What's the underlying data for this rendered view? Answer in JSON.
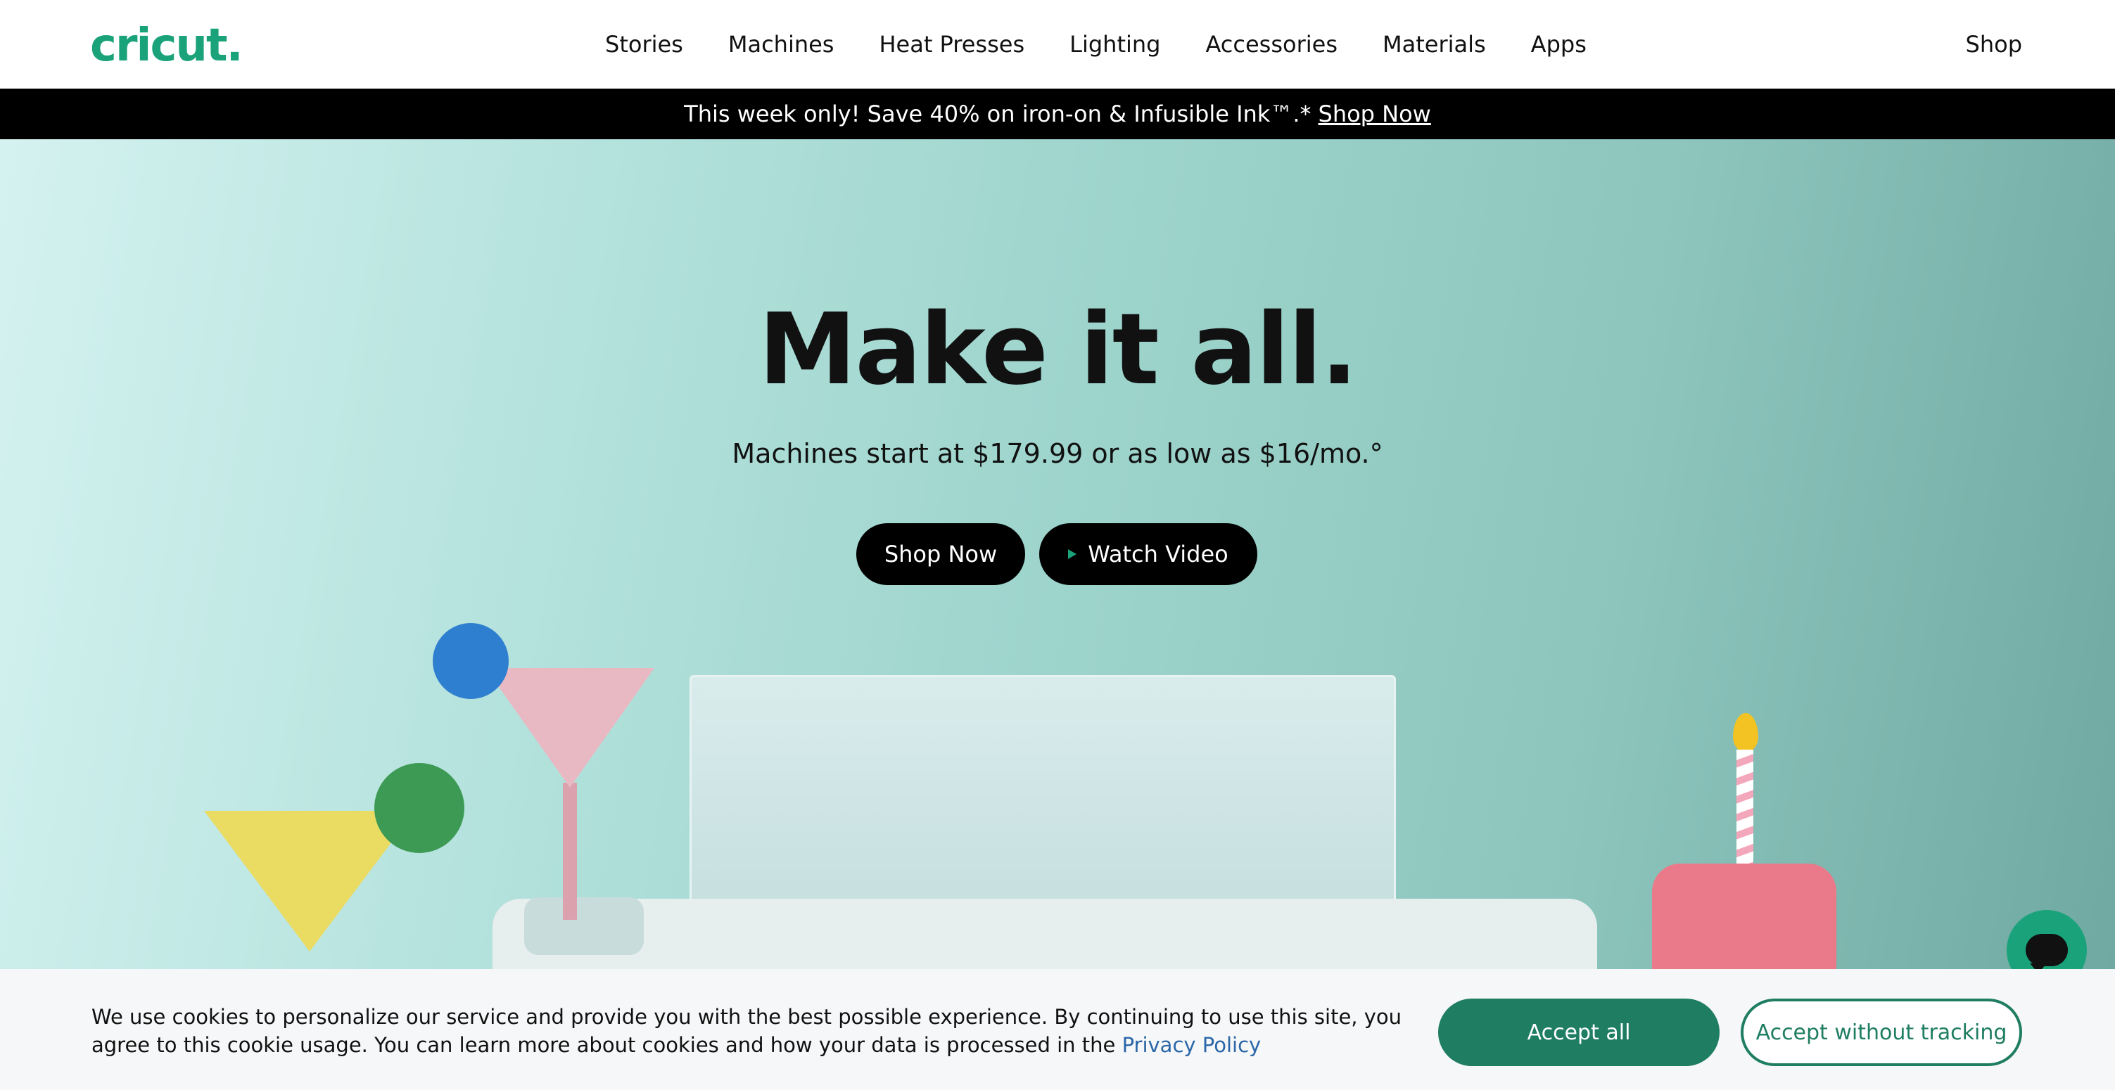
{
  "header": {
    "logo": "cricut.",
    "nav": [
      "Stories",
      "Machines",
      "Heat Presses",
      "Lighting",
      "Accessories",
      "Materials",
      "Apps"
    ],
    "shop": "Shop"
  },
  "promo": {
    "text": "This week only! Save 40% on iron-on & Infusible Ink™.*",
    "link": "Shop Now"
  },
  "hero": {
    "title": "Make it all.",
    "subtitle": "Machines start at $179.99 or as low as $16/mo.°",
    "shop_button": "Shop Now",
    "watch_button": "Watch Video"
  },
  "cookie": {
    "text": "We use cookies to personalize our service and provide you with the best possible experience. By continuing to use this site, you agree to this cookie usage. You can learn more about cookies and how your data is processed in the",
    "link": "Privacy Policy",
    "accept_all": "Accept all",
    "accept_without_tracking": "Accept without tracking"
  },
  "colors": {
    "brand": "#1aa37a",
    "accept_button": "#1f7d62",
    "promo_bar": "#000000"
  }
}
